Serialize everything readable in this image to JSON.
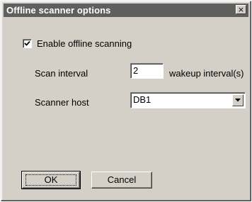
{
  "window": {
    "title": "Offline scanner options",
    "close_symbol": "×"
  },
  "enable_offline": {
    "label": "Enable offline scanning",
    "checked": true
  },
  "scan_interval": {
    "label": "Scan interval",
    "value": "2",
    "unit": "wakeup interval(s)"
  },
  "scanner_host": {
    "label": "Scanner host",
    "value": "DB1"
  },
  "buttons": {
    "ok": "OK",
    "cancel": "Cancel"
  }
}
